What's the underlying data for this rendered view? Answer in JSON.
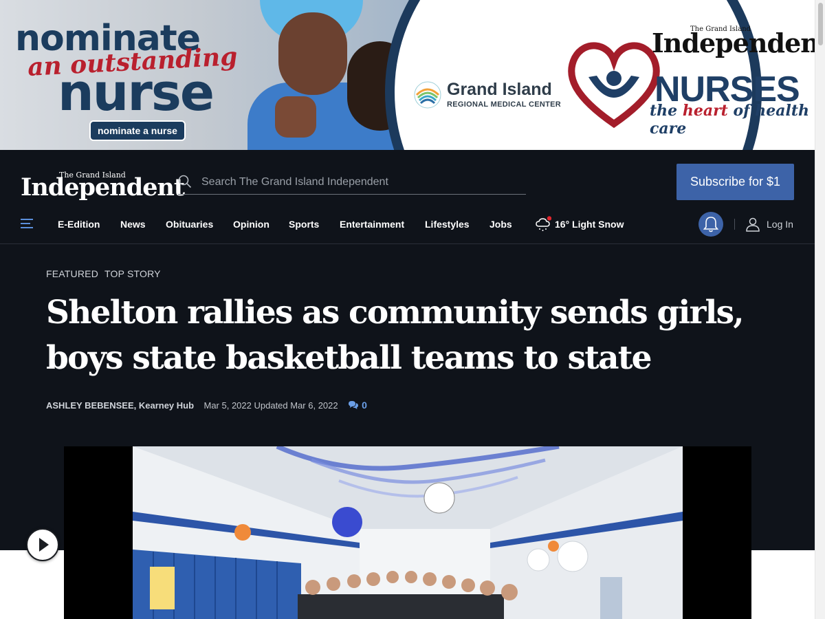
{
  "ad": {
    "left_line1": "nominate",
    "left_line2": "an outstanding",
    "left_line3": "nurse",
    "left_button": "nominate a nurse",
    "hospital_name": "Grand Island",
    "hospital_sub": "REGIONAL MEDICAL CENTER",
    "paper_small": "The Grand Island",
    "paper_name": "Independent",
    "nurses": "NURSES",
    "tagline_pre": "the ",
    "tagline_red": "heart",
    "tagline_post": " of health care"
  },
  "header": {
    "logo_small": "The Grand Island",
    "logo_main": "Independent",
    "search_placeholder": "Search The Grand Island Independent",
    "subscribe_label": "Subscribe for $1"
  },
  "nav": {
    "items": [
      "E-Edition",
      "News",
      "Obituaries",
      "Opinion",
      "Sports",
      "Entertainment",
      "Lifestyles",
      "Jobs"
    ],
    "weather": "16° Light Snow",
    "login": "Log In"
  },
  "article": {
    "tags": [
      "FEATURED",
      "TOP STORY"
    ],
    "headline": "Shelton rallies as community sends girls, boys state basketball teams to state",
    "author": "ASHLEY BEBENSEE, Kearney Hub",
    "dates": "Mar 5, 2022 Updated Mar 6, 2022",
    "comments": "0"
  },
  "colors": {
    "header_bg": "#0f131a",
    "accent_blue": "#3d63a8",
    "link_blue": "#6b9fe8",
    "notification_dot": "#e0262e"
  },
  "icons": [
    "menu-icon",
    "search-icon",
    "weather-snow-icon",
    "bell-icon",
    "user-icon",
    "comment-icon",
    "play-icon"
  ]
}
